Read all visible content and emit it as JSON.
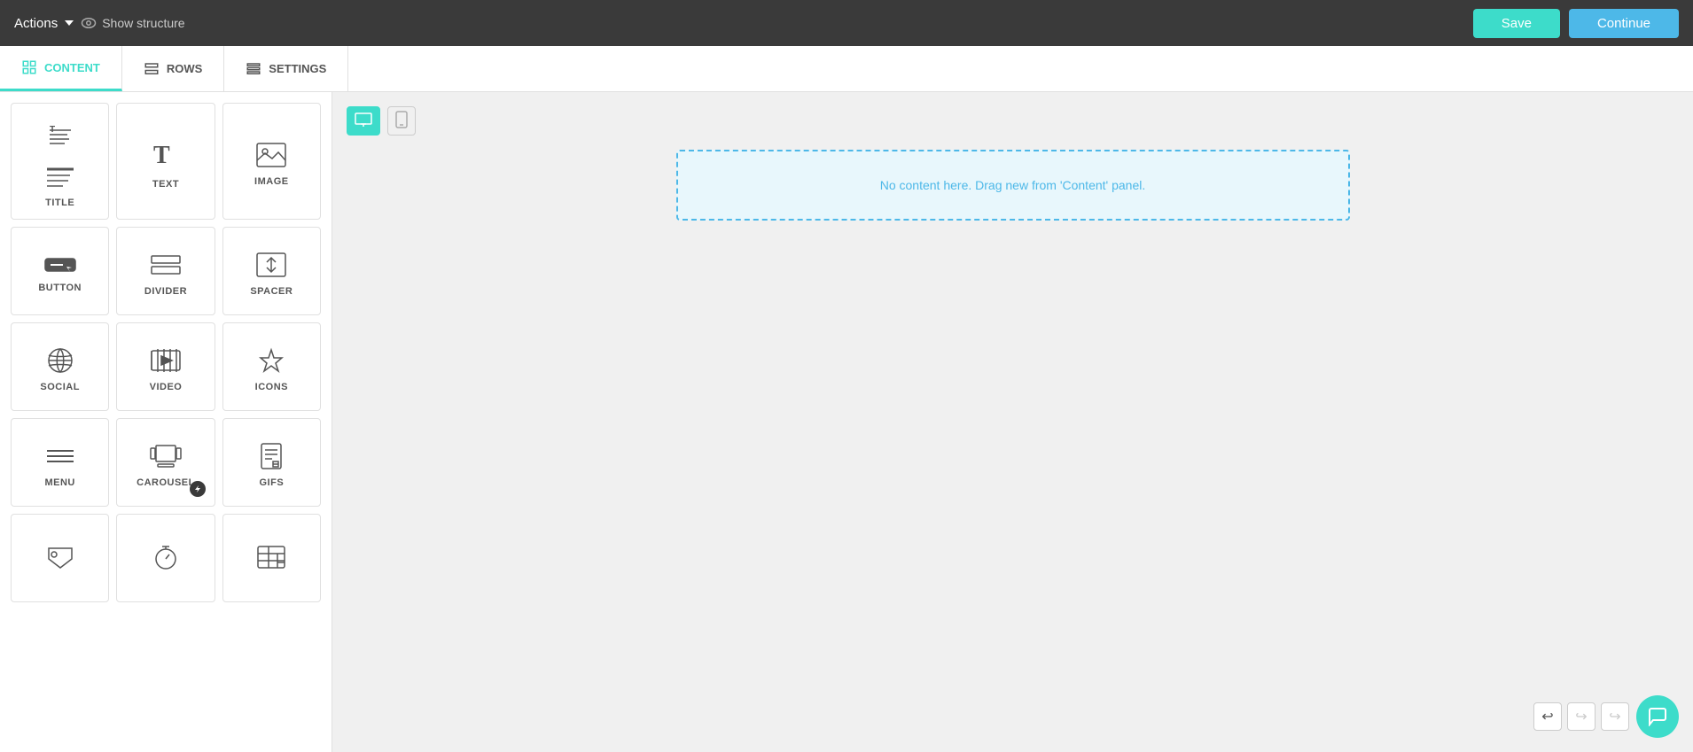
{
  "topbar": {
    "actions_label": "Actions",
    "show_structure_label": "Show structure",
    "save_label": "Save",
    "continue_label": "Continue"
  },
  "tabs": [
    {
      "id": "content",
      "label": "CONTENT",
      "active": true
    },
    {
      "id": "rows",
      "label": "ROWS",
      "active": false
    },
    {
      "id": "settings",
      "label": "SETTINGS",
      "active": false
    }
  ],
  "content_items": [
    {
      "id": "title",
      "label": "TITLE"
    },
    {
      "id": "text",
      "label": "TEXT"
    },
    {
      "id": "image",
      "label": "IMAGE"
    },
    {
      "id": "button",
      "label": "BUTTON"
    },
    {
      "id": "divider",
      "label": "DIVIDER"
    },
    {
      "id": "spacer",
      "label": "SPACER"
    },
    {
      "id": "social",
      "label": "SOCIAL"
    },
    {
      "id": "video",
      "label": "VIDEO"
    },
    {
      "id": "icons",
      "label": "ICONS"
    },
    {
      "id": "menu",
      "label": "MENU"
    },
    {
      "id": "carousel",
      "label": "CAROUSEL",
      "badge": true
    },
    {
      "id": "gifs",
      "label": "GIFS"
    },
    {
      "id": "item13",
      "label": ""
    },
    {
      "id": "item14",
      "label": ""
    },
    {
      "id": "item15",
      "label": ""
    }
  ],
  "canvas": {
    "drop_zone_text": "No content here. Drag new from 'Content' panel.",
    "desktop_label": "Desktop",
    "mobile_label": "Mobile"
  }
}
